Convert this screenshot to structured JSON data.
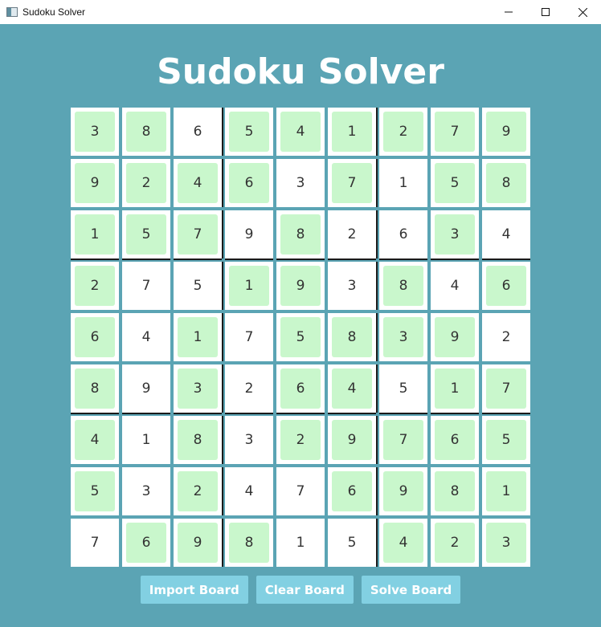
{
  "window": {
    "title": "Sudoku Solver",
    "minimize_icon": "minimize-icon",
    "maximize_icon": "maximize-icon",
    "close_icon": "close-icon"
  },
  "app": {
    "heading": "Sudoku Solver"
  },
  "colors": {
    "background": "#5ba4b4",
    "given_cell": "#c9f7cc",
    "button": "#82d0e2"
  },
  "board": {
    "rows": [
      [
        "3",
        "8",
        "6",
        "5",
        "4",
        "1",
        "2",
        "7",
        "9"
      ],
      [
        "9",
        "2",
        "4",
        "6",
        "3",
        "7",
        "1",
        "5",
        "8"
      ],
      [
        "1",
        "5",
        "7",
        "9",
        "8",
        "2",
        "6",
        "3",
        "4"
      ],
      [
        "2",
        "7",
        "5",
        "1",
        "9",
        "3",
        "8",
        "4",
        "6"
      ],
      [
        "6",
        "4",
        "1",
        "7",
        "5",
        "8",
        "3",
        "9",
        "2"
      ],
      [
        "8",
        "9",
        "3",
        "2",
        "6",
        "4",
        "5",
        "1",
        "7"
      ],
      [
        "4",
        "1",
        "8",
        "3",
        "2",
        "9",
        "7",
        "6",
        "5"
      ],
      [
        "5",
        "3",
        "2",
        "4",
        "7",
        "6",
        "9",
        "8",
        "1"
      ],
      [
        "7",
        "6",
        "9",
        "8",
        "1",
        "5",
        "4",
        "2",
        "3"
      ]
    ],
    "given": [
      [
        1,
        1,
        0,
        1,
        1,
        1,
        1,
        1,
        1
      ],
      [
        1,
        1,
        1,
        1,
        0,
        1,
        0,
        1,
        1
      ],
      [
        1,
        1,
        1,
        0,
        1,
        0,
        0,
        1,
        0
      ],
      [
        1,
        0,
        0,
        1,
        1,
        0,
        1,
        0,
        1
      ],
      [
        1,
        0,
        1,
        0,
        1,
        1,
        1,
        1,
        0
      ],
      [
        1,
        0,
        1,
        0,
        1,
        1,
        0,
        1,
        1
      ],
      [
        1,
        0,
        1,
        0,
        1,
        1,
        1,
        1,
        1
      ],
      [
        1,
        0,
        1,
        0,
        0,
        1,
        1,
        1,
        1
      ],
      [
        0,
        1,
        1,
        1,
        0,
        0,
        1,
        1,
        1
      ]
    ]
  },
  "actions": {
    "import_label": "Import Board",
    "clear_label": "Clear Board",
    "solve_label": "Solve Board"
  }
}
